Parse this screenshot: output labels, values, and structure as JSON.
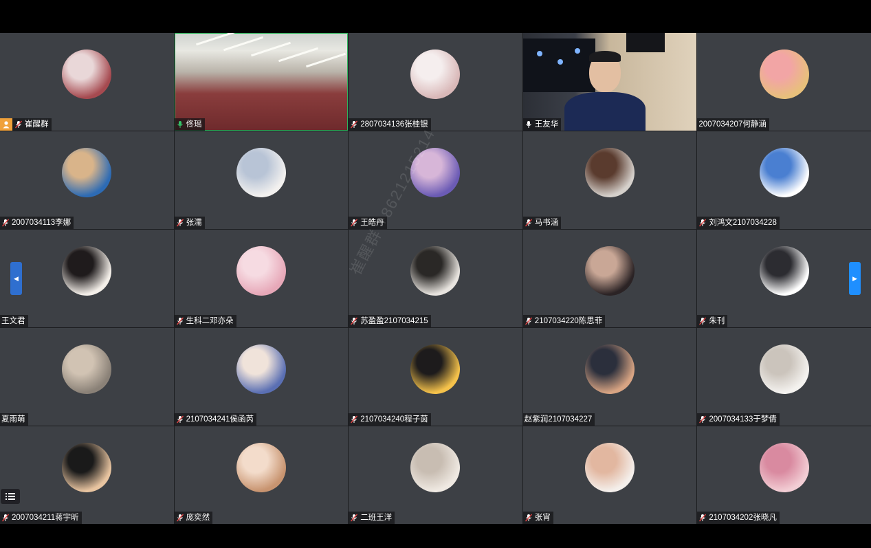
{
  "watermark": "崔醒群 +8621215214",
  "colors": {
    "tile_bg": "#3d4045",
    "grid_bg": "#1c1d20",
    "active_speaker_border": "#2fb35c",
    "host_badge": "#f0a13a",
    "nav_arrow": "#1f8fff"
  },
  "participants": [
    {
      "name": "崔醒群",
      "mic": "muted",
      "host": true,
      "avatar": "avatar-2022",
      "c1": "#a64a50",
      "c2": "#e9d7d8"
    },
    {
      "name": "佟瑶",
      "mic": "active",
      "video": "classroom-video"
    },
    {
      "name": "2807034136张桂银",
      "mic": "muted",
      "avatar": "avatar-girl-hat",
      "c1": "#d9b8b8",
      "c2": "#f5eeee"
    },
    {
      "name": "王友华",
      "mic": "on",
      "video": "teacher-video"
    },
    {
      "name": "2007034207何静涵",
      "mic": "none",
      "avatar": "avatar-cartoon-girl",
      "c1": "#e8c07b",
      "c2": "#f2a5a5"
    },
    {
      "name": "2007034113李娜",
      "mic": "muted",
      "avatar": "avatar-dog-blue",
      "c1": "#2d6bb4",
      "c2": "#d9b48a"
    },
    {
      "name": "张濡",
      "mic": "muted",
      "avatar": "avatar-anime-girl",
      "c1": "#f3f1ef",
      "c2": "#b8c4d6"
    },
    {
      "name": "王皓丹",
      "mic": "muted",
      "avatar": "avatar-anime-couple",
      "c1": "#6b5bb5",
      "c2": "#d7b6d8"
    },
    {
      "name": "马书涵",
      "mic": "muted",
      "avatar": "avatar-girl-back",
      "c1": "#d5d0cb",
      "c2": "#5a3b2e"
    },
    {
      "name": "刘鸿文2107034228",
      "mic": "muted",
      "avatar": "avatar-stitch",
      "c1": "#ffffff",
      "c2": "#4a7fd1"
    },
    {
      "name": "王文君",
      "mic": "none",
      "avatar": "avatar-anime-man",
      "c1": "#f4efe9",
      "c2": "#1f1b1c"
    },
    {
      "name": "生科二邓亦朵",
      "mic": "muted",
      "avatar": "avatar-pink-anime",
      "c1": "#e7a8b8",
      "c2": "#f6dbe2"
    },
    {
      "name": "苏盈盈2107034215",
      "mic": "muted",
      "avatar": "avatar-white-dog",
      "c1": "#e8e4df",
      "c2": "#2a2826"
    },
    {
      "name": "2107034220陈思菲",
      "mic": "muted",
      "avatar": "avatar-girl-dark",
      "c1": "#2b2325",
      "c2": "#c9a796"
    },
    {
      "name": "朱刊",
      "mic": "muted",
      "avatar": "avatar-boy-dark",
      "c1": "#ffffff",
      "c2": "#2c2c31"
    },
    {
      "name": "夏雨萌",
      "mic": "none",
      "avatar": "avatar-girl-hands",
      "c1": "#8a8177",
      "c2": "#d1c3b3"
    },
    {
      "name": "2107034241侯函芮",
      "mic": "muted",
      "avatar": "avatar-anime-mask",
      "c1": "#5a6fb3",
      "c2": "#f0e3da"
    },
    {
      "name": "2107034240程子茵",
      "mic": "muted",
      "avatar": "avatar-cartoon-glasses",
      "c1": "#f5c24b",
      "c2": "#1d1b1c"
    },
    {
      "name": "赵紫润2107034227",
      "mic": "none",
      "avatar": "avatar-child-bow",
      "c1": "#d8a483",
      "c2": "#2b2f3c"
    },
    {
      "name": "2007034133于梦倩",
      "mic": "muted",
      "avatar": "avatar-samoyed",
      "c1": "#f4f2ef",
      "c2": "#cbc4bc"
    },
    {
      "name": "2007034211蒋宇昕",
      "mic": "muted",
      "avatar": "avatar-cat-sunglasses",
      "c1": "#e8c4a0",
      "c2": "#1a1a1a"
    },
    {
      "name": "庞奕然",
      "mic": "muted",
      "avatar": "avatar-child-bob",
      "c1": "#c89470",
      "c2": "#f3dccb"
    },
    {
      "name": "二班王洋",
      "mic": "muted",
      "avatar": "avatar-puppy",
      "c1": "#efe9e2",
      "c2": "#c8bdb2"
    },
    {
      "name": "张宵",
      "mic": "muted",
      "avatar": "avatar-child-hat",
      "c1": "#f4efeb",
      "c2": "#e2b7a0"
    },
    {
      "name": "2107034202张晓凡",
      "mic": "muted",
      "avatar": "avatar-child-pink",
      "c1": "#f2cdd4",
      "c2": "#d98aa0"
    }
  ]
}
